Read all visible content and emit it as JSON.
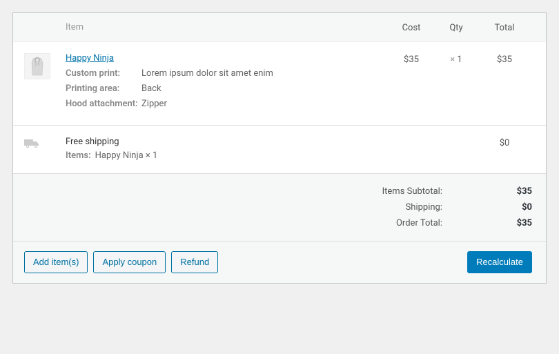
{
  "headers": {
    "item": "Item",
    "cost": "Cost",
    "qty": "Qty",
    "total": "Total"
  },
  "line_item": {
    "name": "Happy Ninja",
    "cost": "$35",
    "qty_prefix": "× ",
    "qty": "1",
    "total": "$35",
    "meta": {
      "custom_print_label": "Custom print:",
      "custom_print_value": "Lorem ipsum dolor sit amet enim",
      "printing_area_label": "Printing area:",
      "printing_area_value": "Back",
      "hood_label": "Hood attachment:",
      "hood_value": "Zipper"
    }
  },
  "shipping": {
    "name": "Free shipping",
    "total": "$0",
    "items_label": "Items:",
    "items_value": "Happy Ninja × 1"
  },
  "totals": {
    "subtotal_label": "Items Subtotal:",
    "subtotal_value": "$35",
    "shipping_label": "Shipping:",
    "shipping_value": "$0",
    "order_total_label": "Order Total:",
    "order_total_value": "$35"
  },
  "actions": {
    "add_items": "Add item(s)",
    "apply_coupon": "Apply coupon",
    "refund": "Refund",
    "recalculate": "Recalculate"
  }
}
